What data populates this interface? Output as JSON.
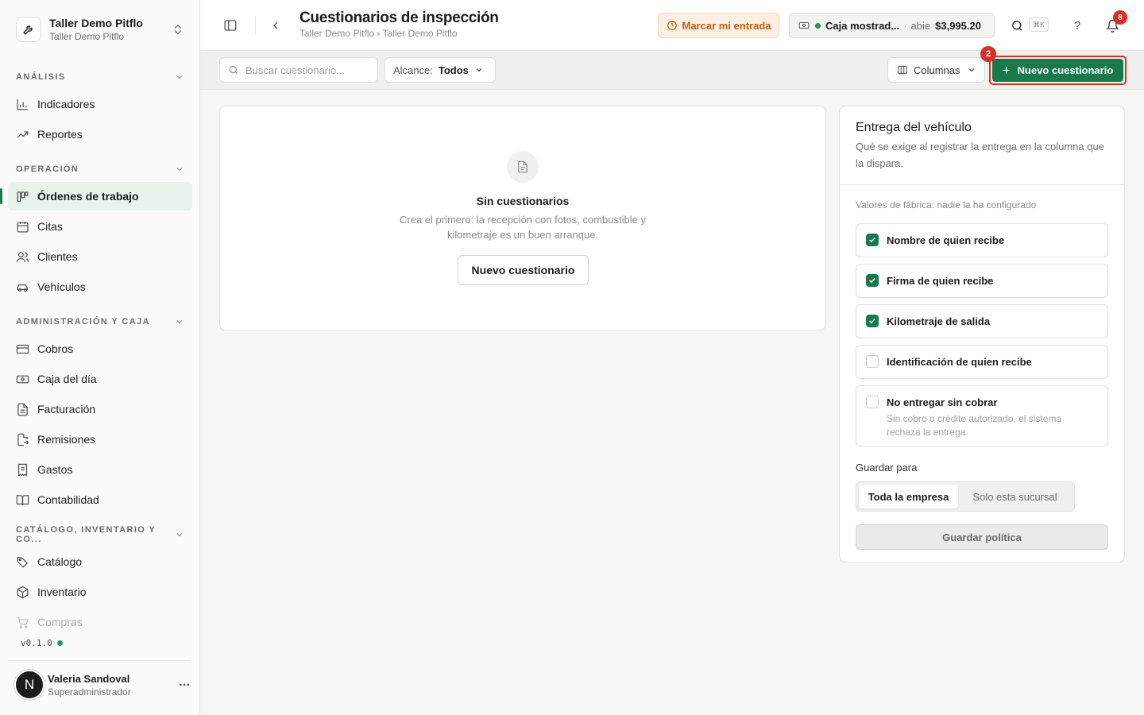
{
  "sidebar": {
    "org": {
      "name": "Taller Demo Pitflo",
      "subtitle": "Taller Demo Pitflo"
    },
    "sections": {
      "analisis": "ANÁLISIS",
      "operacion": "OPERACIÓN",
      "administracion": "ADMINISTRACIÓN Y CAJA",
      "catalogo": "CATÁLOGO, INVENTARIO Y CO..."
    },
    "items": {
      "indicadores": "Indicadores",
      "reportes": "Reportes",
      "ordenes": "Órdenes de trabajo",
      "citas": "Citas",
      "clientes": "Clientes",
      "vehiculos": "Vehículos",
      "cobros": "Cobros",
      "caja": "Caja del día",
      "facturacion": "Facturación",
      "remisiones": "Remisiones",
      "gastos": "Gastos",
      "contabilidad": "Contabilidad",
      "catalogo": "Catálogo",
      "inventario": "Inventario",
      "compras": "Compras"
    },
    "version": "v0.1.0",
    "user": {
      "initial": "N",
      "name": "Valeria Sandoval",
      "role": "Superadministrador"
    }
  },
  "header": {
    "title": "Cuestionarios de inspección",
    "breadcrumb": "Taller Demo Pitflo › Taller Demo Pitflo",
    "checkin_label": "Marcar mi entrada",
    "cashbox": {
      "name": "Caja mostrad...",
      "status": "abie",
      "amount": "$3,995.20"
    },
    "shortcut": "⌘K",
    "help": "?",
    "notifications_count": "8"
  },
  "toolbar": {
    "search_placeholder": "Buscar cuestionario...",
    "scope_label": "Alcance:",
    "scope_value": "Todos",
    "columns_label": "Columnas",
    "new_button": "Nuevo cuestionario",
    "step_badge": "2"
  },
  "empty": {
    "title": "Sin cuestionarios",
    "description": "Crea el primero: la recepción con fotos, combustible y kilometraje es un buen arranque.",
    "button": "Nuevo cuestionario"
  },
  "policy": {
    "title": "Entrega del vehículo",
    "description": "Qué se exige al registrar la entrega en la columna que la dispara.",
    "factory_note": "Valores de fábrica: nadie la ha configurado",
    "options": [
      {
        "label": "Nombre de quien recibe",
        "checked": true
      },
      {
        "label": "Firma de quien recibe",
        "checked": true
      },
      {
        "label": "Kilometraje de salida",
        "checked": true
      },
      {
        "label": "Identificación de quien recibe",
        "checked": false
      },
      {
        "label": "No entregar sin cobrar",
        "checked": false,
        "description": "Sin cobro o crédito autorizado, el sistema rechaza la entrega."
      }
    ],
    "save_for_label": "Guardar para",
    "scope_options": [
      "Toda la empresa",
      "Solo esta sucursal"
    ],
    "save_button": "Guardar política"
  },
  "colors": {
    "accent": "#18794a",
    "alert": "#d93025",
    "checkin_text": "#b85e12",
    "checkin_bg": "#fdf0e2"
  }
}
